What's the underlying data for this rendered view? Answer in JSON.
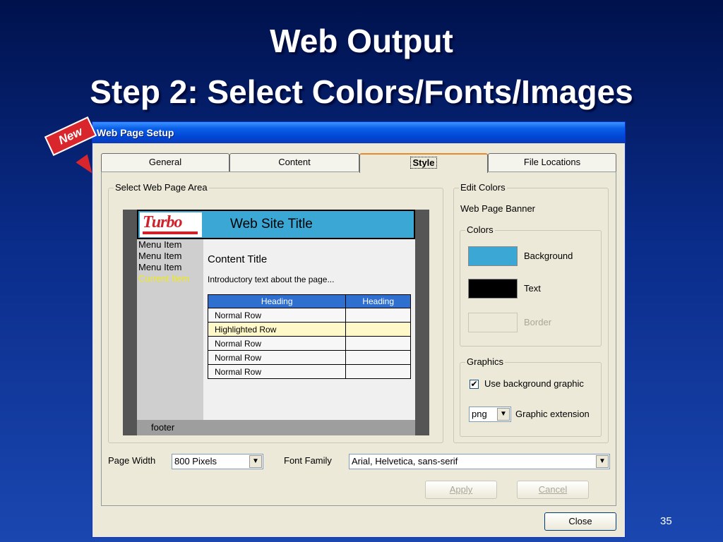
{
  "slide": {
    "title_line1": "Web Output",
    "title_line2": "Step 2: Select Colors/Fonts/Images",
    "badge": "New",
    "page_number": "35"
  },
  "dialog": {
    "title": "Web Page Setup",
    "tabs": [
      {
        "label": "General"
      },
      {
        "label": "Content"
      },
      {
        "label": "Style",
        "active": true
      },
      {
        "label": "File Locations"
      }
    ],
    "select_area": {
      "group_label": "Select Web Page Area",
      "preview": {
        "logo_text": "Turbo",
        "site_title": "Web Site Title",
        "menu_items": [
          "Menu Item",
          "Menu Item",
          "Menu Item"
        ],
        "current_item": "Current Item",
        "content_title": "Content Title",
        "intro_text": "Introductory text about the page...",
        "table_headings": [
          "Heading",
          "Heading"
        ],
        "rows": [
          "Normal Row",
          "Highlighted Row",
          "Normal Row",
          "Normal Row",
          "Normal Row"
        ],
        "footer": "footer"
      }
    },
    "edit_colors": {
      "group_label": "Edit Colors",
      "selected_area": "Web Page Banner",
      "colors_group_label": "Colors",
      "colors": [
        {
          "label": "Background",
          "value": "#3aa7d4",
          "enabled": true
        },
        {
          "label": "Text",
          "value": "#000000",
          "enabled": true
        },
        {
          "label": "Border",
          "value": "#ece9d8",
          "enabled": false
        }
      ],
      "graphics_group_label": "Graphics",
      "use_background_graphic_label": "Use background graphic",
      "use_background_graphic": true,
      "graphic_extension_value": "png",
      "graphic_extension_label": "Graphic extension"
    },
    "page_width_label": "Page Width",
    "page_width_value": "800 Pixels",
    "font_family_label": "Font Family",
    "font_family_value": "Arial, Helvetica, sans-serif",
    "apply_label": "Apply",
    "cancel_label": "Cancel",
    "close_label": "Close"
  }
}
